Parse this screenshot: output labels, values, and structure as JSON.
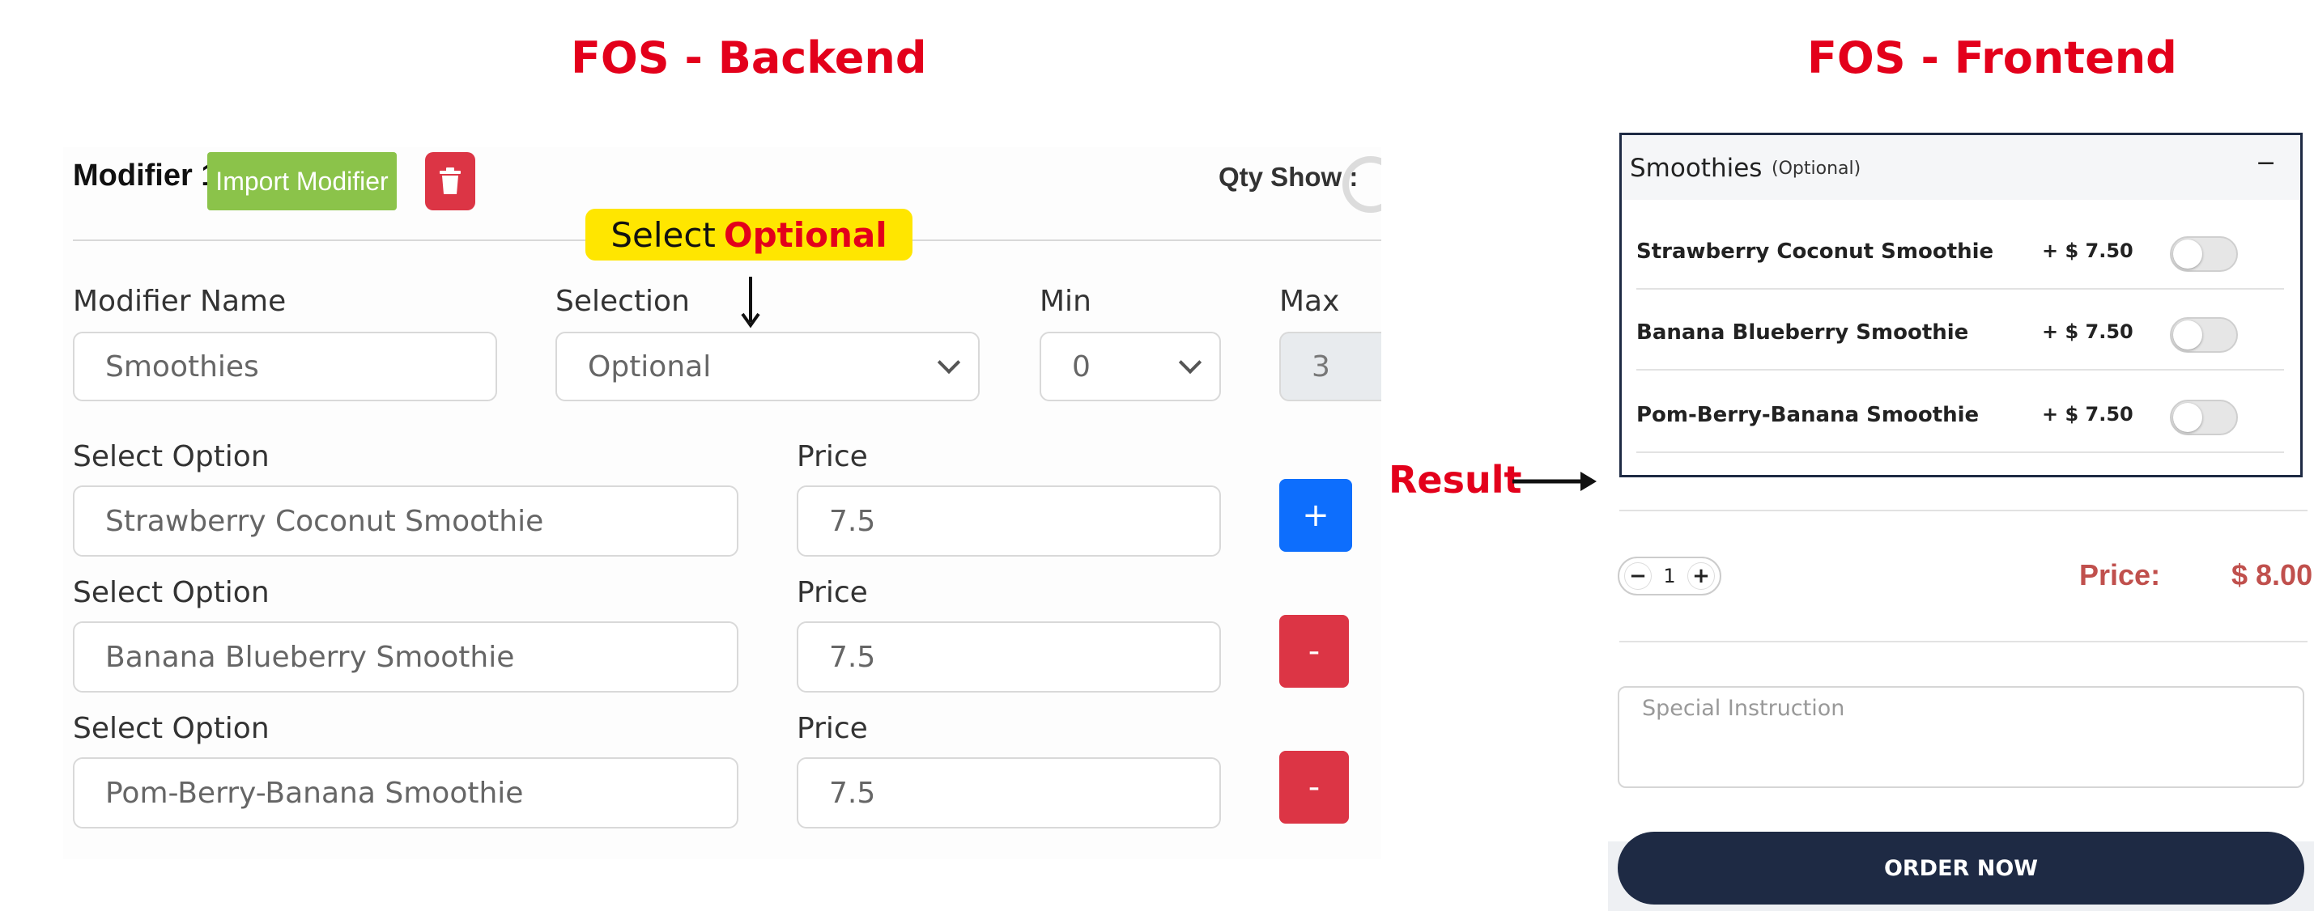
{
  "titles": {
    "backend": "FOS - Backend",
    "frontend": "FOS - Frontend"
  },
  "callout": {
    "prefix": "Select",
    "highlight": "Optional"
  },
  "result_label": "Result",
  "backend": {
    "modifier_title": "Modifier 1",
    "import_button": "Import Modifier",
    "qty_show_label": "Qty Show :",
    "labels": {
      "name": "Modifier Name",
      "selection": "Selection",
      "min": "Min",
      "max": "Max"
    },
    "name_value": "Smoothies",
    "selection_value": "Optional",
    "min_value": "0",
    "max_value": "3",
    "option_label": "Select Option",
    "price_label": "Price",
    "options": [
      {
        "name": "Strawberry Coconut Smoothie",
        "price": "7.5",
        "action": "+"
      },
      {
        "name": "Banana Blueberry Smoothie",
        "price": "7.5",
        "action": "-"
      },
      {
        "name": "Pom-Berry-Banana Smoothie",
        "price": "7.5",
        "action": "-"
      }
    ]
  },
  "frontend": {
    "group_title": "Smoothies",
    "group_badge": "(Optional)",
    "collapse_symbol": "−",
    "items": [
      {
        "name": "Strawberry Coconut Smoothie",
        "price": "+ $ 7.50"
      },
      {
        "name": "Banana Blueberry Smoothie",
        "price": "+ $ 7.50"
      },
      {
        "name": "Pom-Berry-Banana Smoothie",
        "price": "+ $ 7.50"
      }
    ],
    "qty": {
      "minus": "−",
      "value": "1",
      "plus": "+"
    },
    "price_label": "Price:",
    "price_value": "$ 8.00",
    "special_placeholder": "Special Instruction",
    "order_button": "ORDER NOW"
  },
  "colors": {
    "title_red": "#e3001b",
    "import_green": "#8bc34a",
    "danger_red": "#dc3545",
    "primary_blue": "#0d6efd",
    "callout_yellow": "#ffe600",
    "order_navy": "#1e2a44",
    "price_red": "#c0504d"
  }
}
